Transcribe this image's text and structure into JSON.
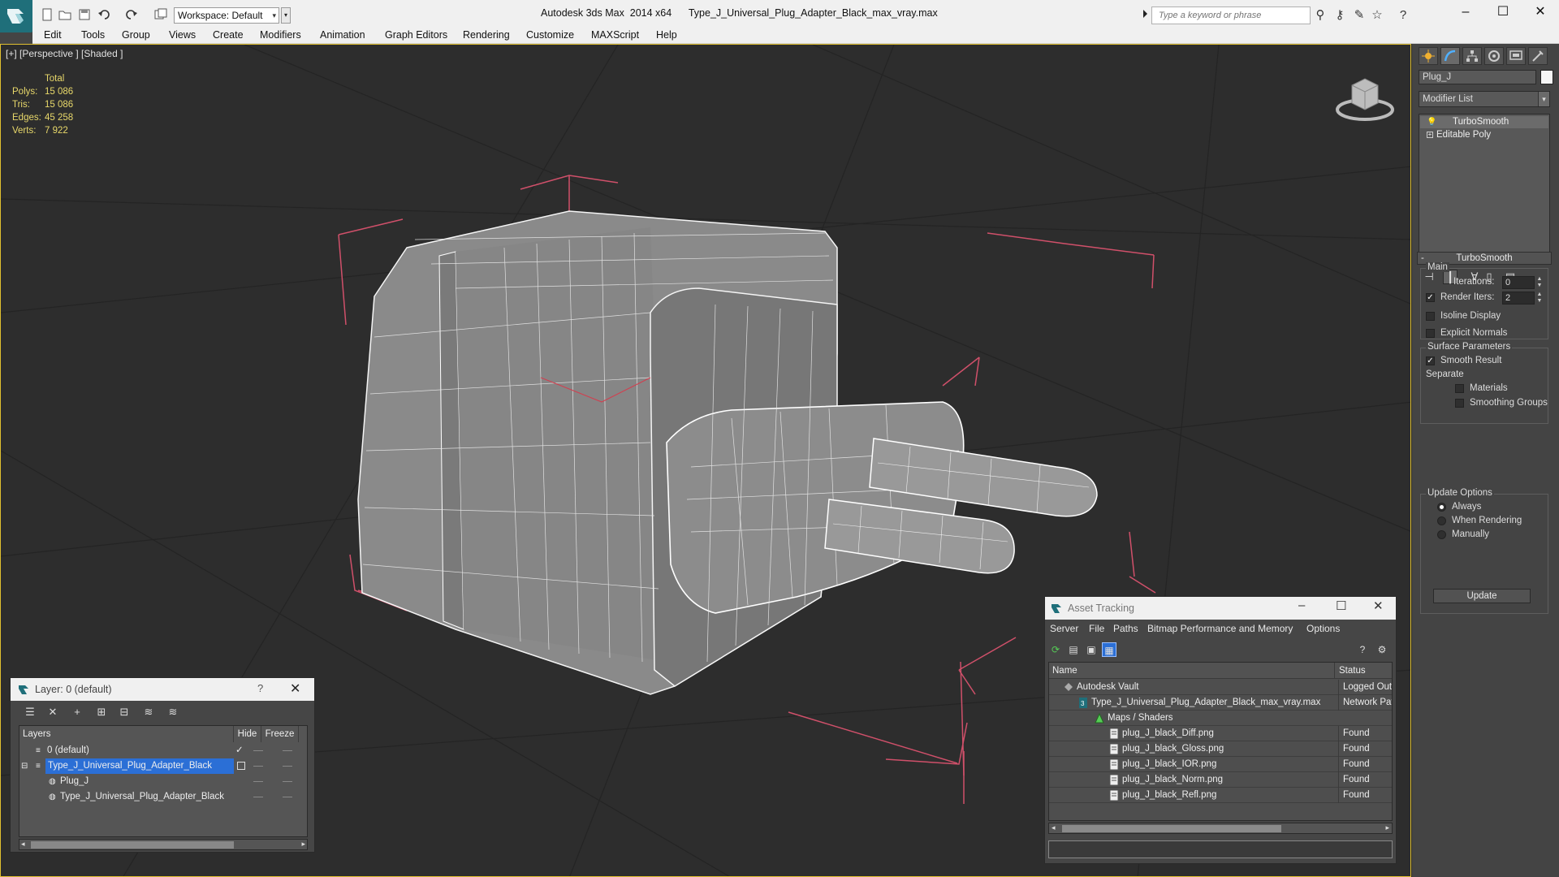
{
  "app": {
    "title": "Autodesk 3ds Max  2014 x64",
    "file": "Type_J_Universal_Plug_Adapter_Black_max_vray.max",
    "workspace": "Workspace: Default",
    "search_placeholder": "Type a keyword or phrase"
  },
  "menu": [
    "Edit",
    "Tools",
    "Group",
    "Views",
    "Create",
    "Modifiers",
    "Animation",
    "Graph Editors",
    "Rendering",
    "Customize",
    "MAXScript",
    "Help"
  ],
  "viewport": {
    "label": "[+] [Perspective ] [Shaded ]",
    "stats": {
      "header": "Total",
      "rows": [
        {
          "k": "Polys:",
          "v": "15 086"
        },
        {
          "k": "Tris:",
          "v": "15 086"
        },
        {
          "k": "Edges:",
          "v": "45 258"
        },
        {
          "k": "Verts:",
          "v": "7 922"
        }
      ]
    }
  },
  "command_panel": {
    "object_name": "Plug_J",
    "modifier_list": "Modifier List",
    "stack": [
      "TurboSmooth",
      "Editable Poly"
    ],
    "rollout": "TurboSmooth",
    "main_group": "Main",
    "iterations_label": "Iterations:",
    "iterations_value": "0",
    "render_iters_label": "Render Iters:",
    "render_iters_value": "2",
    "isoline": "Isoline Display",
    "explicit_normals": "Explicit Normals",
    "surface_group": "Surface Parameters",
    "smooth_result": "Smooth Result",
    "separate": "Separate",
    "materials": "Materials",
    "smoothing_groups": "Smoothing Groups",
    "update_group": "Update Options",
    "always": "Always",
    "when_rendering": "When Rendering",
    "manually": "Manually",
    "update_button": "Update"
  },
  "layer_dialog": {
    "title": "Layer: 0 (default)",
    "help": "?",
    "col_layers": "Layers",
    "col_hide": "Hide",
    "col_freeze": "Freeze",
    "rows": [
      {
        "name": "0 (default)"
      },
      {
        "name": "Type_J_Universal_Plug_Adapter_Black"
      },
      {
        "name": "Plug_J"
      },
      {
        "name": "Type_J_Universal_Plug_Adapter_Black"
      }
    ]
  },
  "asset_dialog": {
    "title": "Asset Tracking",
    "menu": [
      "Server",
      "File",
      "Paths",
      "Bitmap Performance and Memory",
      "Options"
    ],
    "col_name": "Name",
    "col_status": "Status",
    "rows": [
      {
        "name": "Autodesk Vault",
        "status": "Logged Out"
      },
      {
        "name": "Type_J_Universal_Plug_Adapter_Black_max_vray.max",
        "status": "Network Pat"
      },
      {
        "name": "Maps / Shaders",
        "status": ""
      },
      {
        "name": "plug_J_black_Diff.png",
        "status": "Found"
      },
      {
        "name": "plug_J_black_Gloss.png",
        "status": "Found"
      },
      {
        "name": "plug_J_black_IOR.png",
        "status": "Found"
      },
      {
        "name": "plug_J_black_Norm.png",
        "status": "Found"
      },
      {
        "name": "plug_J_black_Refl.png",
        "status": "Found"
      }
    ]
  },
  "colors": {
    "bbox": "#d0506a",
    "stats": "#e8d86a",
    "viewport_border": "#e0c030",
    "selection": "#2b6fd6"
  }
}
